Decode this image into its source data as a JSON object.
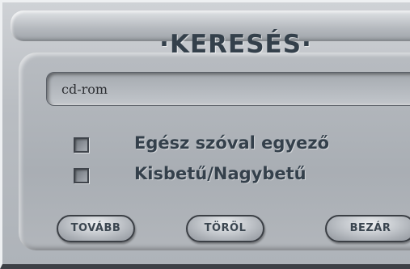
{
  "dialog": {
    "title": "·KERESÉS·"
  },
  "search": {
    "value": "cd-rom"
  },
  "options": [
    {
      "label": "Egész szóval egyező",
      "checked": false
    },
    {
      "label": "Kisbetű/Nagybetű",
      "checked": false
    }
  ],
  "buttons": {
    "next_label": "TOVÁBB",
    "clear_label": "TÖRÖL",
    "close_label": "BEZÁR"
  }
}
